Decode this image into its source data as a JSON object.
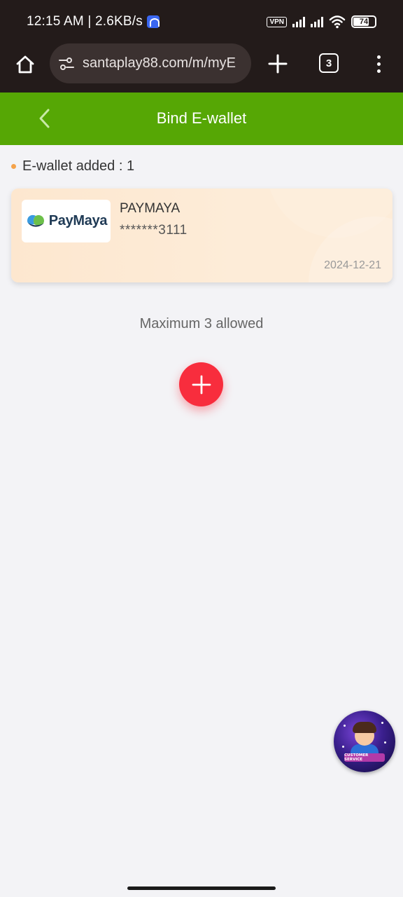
{
  "status_bar": {
    "time_speed": "12:15 AM | 2.6KB/s",
    "vpn": "VPN",
    "battery": "74"
  },
  "browser": {
    "url": "santaplay88.com/m/myE",
    "tab_count": "3"
  },
  "header": {
    "title": "Bind E-wallet"
  },
  "wallet_count": {
    "text": "E-wallet added : 1"
  },
  "wallets": [
    {
      "logo_text": "PayMaya",
      "name": "PAYMAYA",
      "account": "*******3111",
      "date": "2024-12-21"
    }
  ],
  "max_note": "Maximum 3 allowed",
  "customer_service": {
    "label": "CUSTOMER SERVICE"
  },
  "colors": {
    "header_green": "#56a705",
    "add_red": "#f82d3d",
    "card_bg": "#fde7cf",
    "dot_orange": "#f5a34a"
  }
}
